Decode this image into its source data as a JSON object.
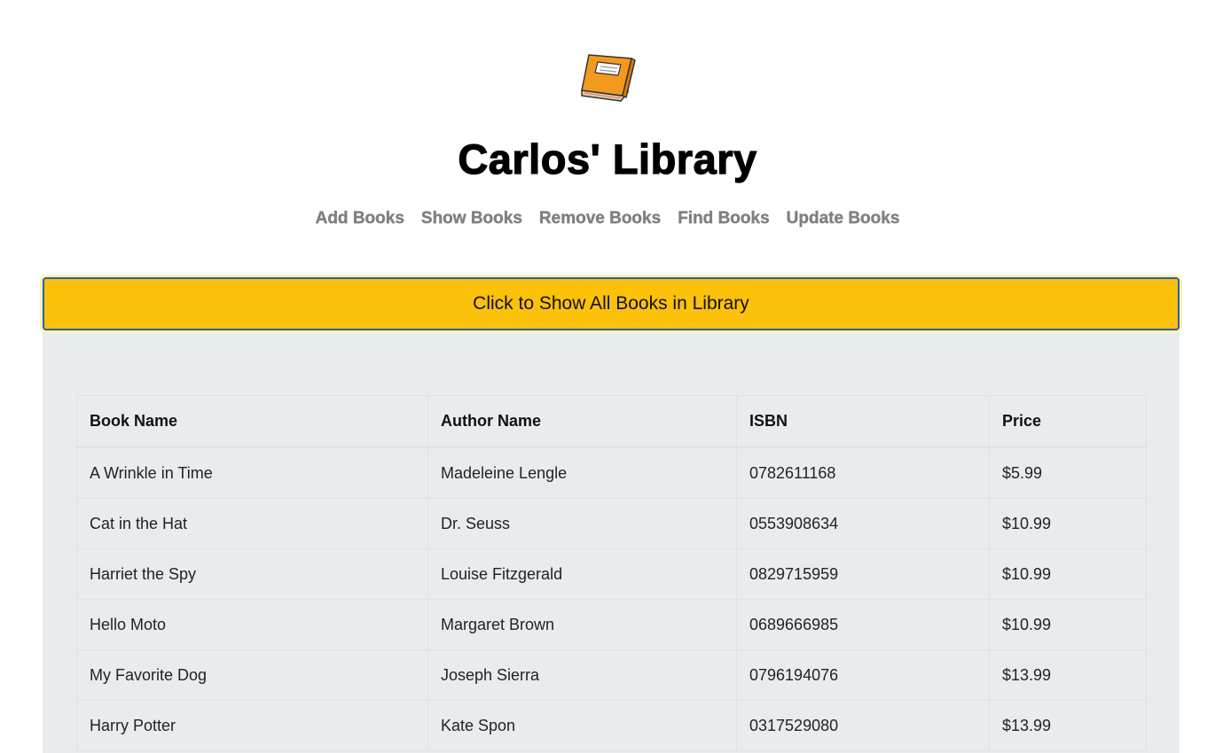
{
  "header": {
    "logo_icon": "book-icon",
    "title": "Carlos' Library"
  },
  "nav": {
    "items": [
      {
        "label": "Add Books"
      },
      {
        "label": "Show Books"
      },
      {
        "label": "Remove Books"
      },
      {
        "label": "Find Books"
      },
      {
        "label": "Update Books"
      }
    ]
  },
  "main": {
    "show_button_label": "Click to Show All Books in Library",
    "table": {
      "columns": [
        "Book Name",
        "Author Name",
        "ISBN",
        "Price"
      ],
      "rows": [
        [
          "A Wrinkle in Time",
          "Madeleine Lengle",
          "0782611168",
          "$5.99"
        ],
        [
          "Cat in the Hat",
          "Dr. Seuss",
          "0553908634",
          "$10.99"
        ],
        [
          "Harriet the Spy",
          "Louise Fitzgerald",
          "0829715959",
          "$10.99"
        ],
        [
          "Hello Moto",
          "Margaret Brown",
          "0689666985",
          "$10.99"
        ],
        [
          "My Favorite Dog",
          "Joseph Sierra",
          "0796194076",
          "$13.99"
        ],
        [
          "Harry Potter",
          "Kate Spon",
          "0317529080",
          "$13.99"
        ]
      ]
    }
  },
  "colors": {
    "button_bg": "#fbc10b",
    "button_border": "#2b5cb0",
    "panel_bg": "#e8ecef",
    "nav_text": "#808080"
  }
}
